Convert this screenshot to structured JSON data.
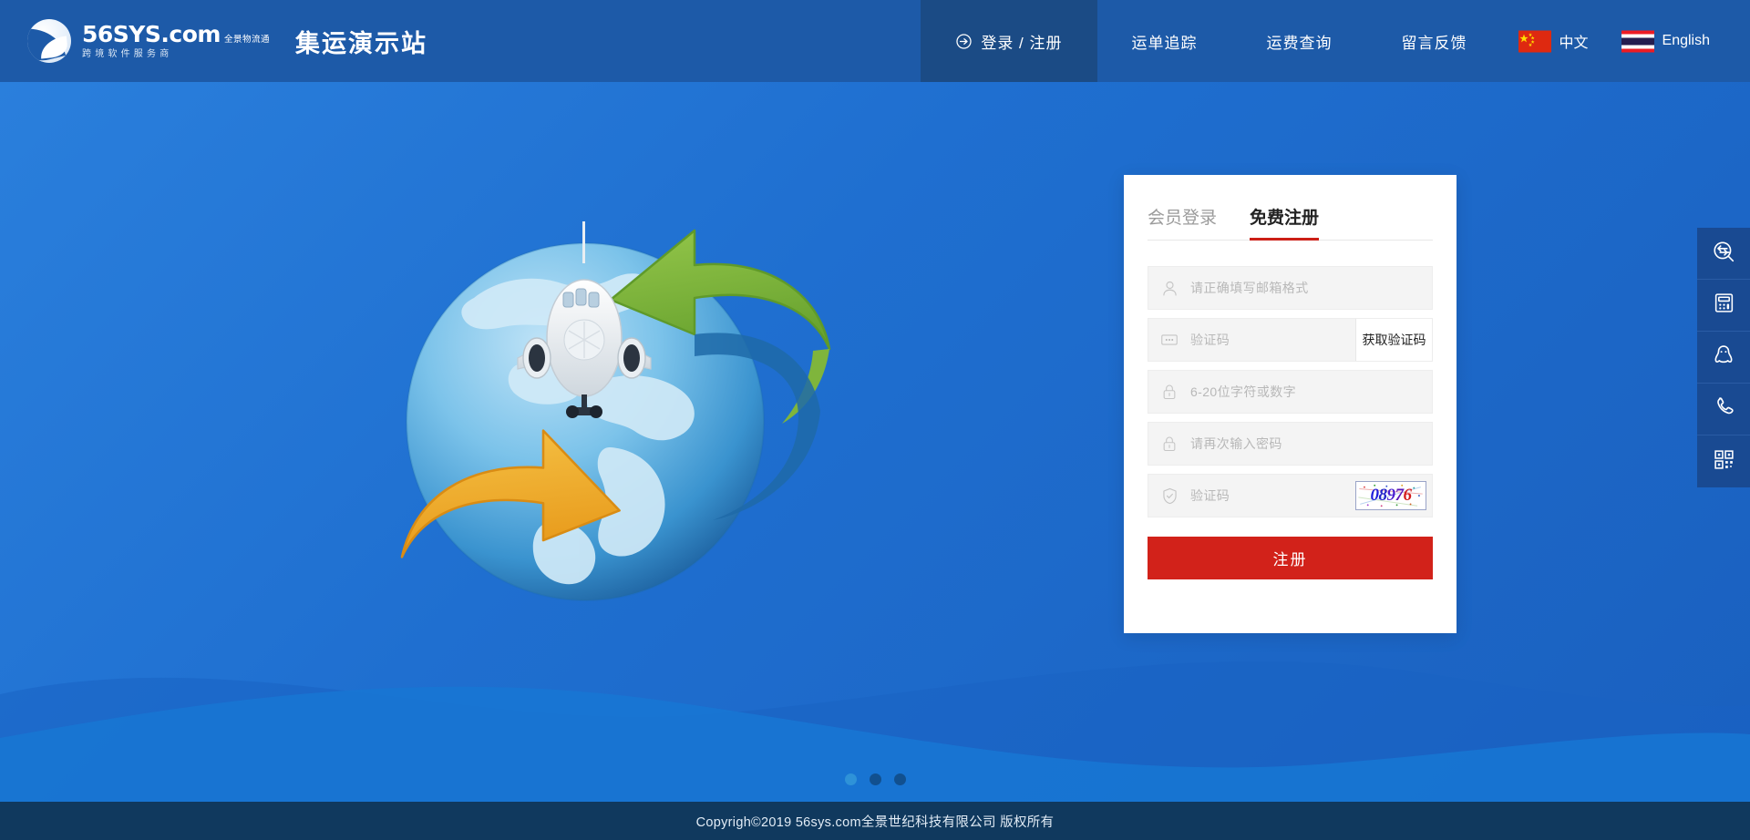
{
  "header": {
    "logo": {
      "mark": "swoosh-logo-icon",
      "name": "56SYS.com",
      "tagline_top": "全景物流通",
      "tagline_bottom": "跨境软件服务商"
    },
    "site_title": "集运演示站",
    "nav": [
      {
        "label": "登录 / 注册",
        "icon": "arrow-right-circle-icon",
        "active": true
      },
      {
        "label": "运单追踪",
        "icon": "",
        "active": false
      },
      {
        "label": "运费查询",
        "icon": "",
        "active": false
      },
      {
        "label": "留言反馈",
        "icon": "",
        "active": false
      }
    ],
    "languages": [
      {
        "label": "中文",
        "flag": "china-flag-icon"
      },
      {
        "label": "English",
        "flag": "thailand-flag-icon"
      }
    ]
  },
  "hero": {
    "illustration": "globe-airplane-arrows-illustration",
    "carousel_dots": [
      {
        "state": "light"
      },
      {
        "state": "dark"
      },
      {
        "state": "dark"
      }
    ]
  },
  "card": {
    "tabs": [
      {
        "label": "会员登录",
        "active": false
      },
      {
        "label": "免费注册",
        "active": true
      }
    ],
    "fields": [
      {
        "name": "email",
        "icon": "user-icon",
        "placeholder": "请正确填写邮箱格式",
        "value": ""
      },
      {
        "name": "verify-code",
        "icon": "dots-box-icon",
        "placeholder": "验证码",
        "value": "",
        "button": "获取验证码"
      },
      {
        "name": "password",
        "icon": "lock-icon",
        "placeholder": "6-20位字符或数字",
        "value": ""
      },
      {
        "name": "confirm-password",
        "icon": "lock-icon",
        "placeholder": "请再次输入密码",
        "value": ""
      },
      {
        "name": "captcha",
        "icon": "shield-check-icon",
        "placeholder": "验证码",
        "value": "",
        "captcha_text": "08976"
      }
    ],
    "submit_label": "注册"
  },
  "rail": [
    {
      "icon": "track-search-icon",
      "name": "waybill-tracking"
    },
    {
      "icon": "calculator-icon",
      "name": "freight-calculator"
    },
    {
      "icon": "qq-penguin-icon",
      "name": "qq-chat"
    },
    {
      "icon": "phone-icon",
      "name": "hotline"
    },
    {
      "icon": "qrcode-icon",
      "name": "qr-code"
    }
  ],
  "footer": {
    "copyright": "Copyrigh©2019 56sys.com全景世纪科技有限公司 版权所有"
  },
  "colors": {
    "header_bg": "#1d5aa8",
    "header_active": "#1b4b85",
    "hero_bg": "#1f6fd0",
    "accent_red": "#cc1f16",
    "submit_red": "#d2221a",
    "footer_bg": "#10395e",
    "rail_bg": "#194a92"
  }
}
